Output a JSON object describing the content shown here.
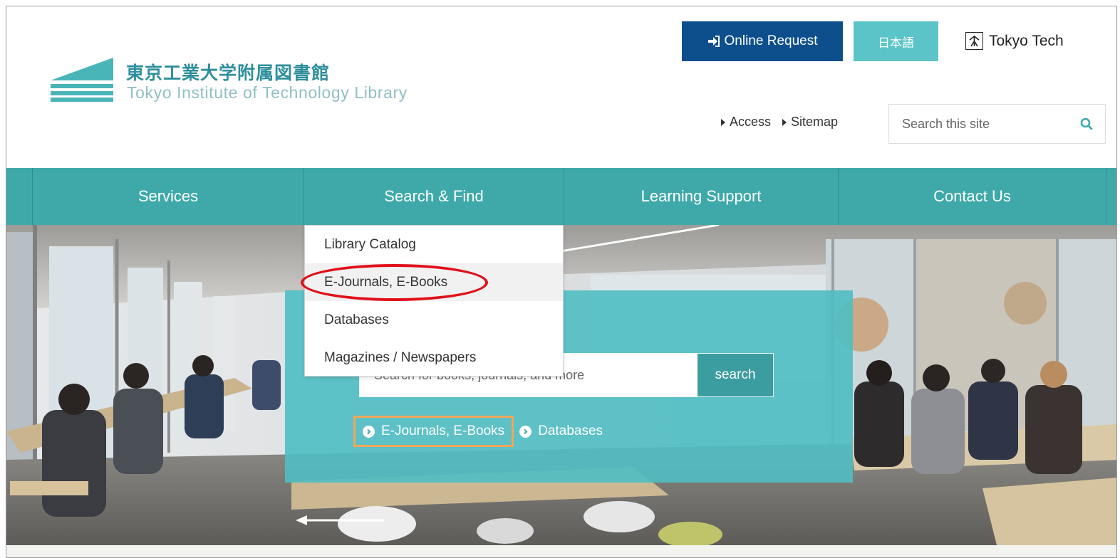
{
  "header": {
    "logo_jp": "東京工業大学附属図書館",
    "logo_en": "Tokyo Institute of Technology Library",
    "online_request_label": "Online Request",
    "language_label": "日本語",
    "partner_logo_label": "Tokyo Tech",
    "util_links": [
      "Access",
      "Sitemap"
    ],
    "site_search_placeholder": "Search this site"
  },
  "nav": {
    "items": [
      "Services",
      "Search & Find",
      "Learning Support",
      "Contact Us"
    ]
  },
  "dropdown": {
    "items": [
      "Library Catalog",
      "E-Journals, E-Books",
      "Databases",
      "Magazines / Newspapers"
    ],
    "highlighted": "E-Journals, E-Books"
  },
  "hero": {
    "catalog_search_placeholder": "Search for books, journals, and more",
    "search_button_label": "search",
    "quick_links": [
      "E-Journals, E-Books",
      "Databases"
    ]
  },
  "colors": {
    "teal_nav": "#3fa9a9",
    "navy_button": "#0d4f8c",
    "light_teal": "#5bc4c8",
    "annotation_red": "#e0101a",
    "annotation_orange": "#f2a65a"
  }
}
